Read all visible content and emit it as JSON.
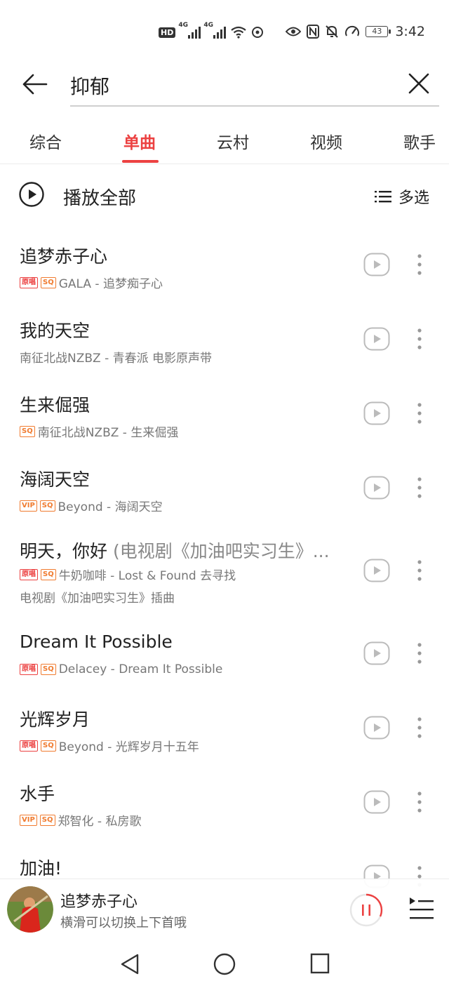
{
  "status_bar": {
    "time": "3:42",
    "battery": "43",
    "hd_label": "HD",
    "network_labels": [
      "4G",
      "4G"
    ],
    "icons": [
      "hd-icon",
      "signal-icon",
      "signal-icon",
      "wifi-icon",
      "sync-icon",
      "eye-icon",
      "nfc-icon",
      "bell-off-icon",
      "speedometer-icon",
      "battery-icon"
    ]
  },
  "search": {
    "query": "抑郁",
    "back_icon": "arrow-left-icon",
    "clear_icon": "close-icon"
  },
  "tabs": [
    {
      "label": "综合",
      "active": false
    },
    {
      "label": "单曲",
      "active": true
    },
    {
      "label": "云村",
      "active": false
    },
    {
      "label": "视频",
      "active": false
    },
    {
      "label": "歌手",
      "active": false
    }
  ],
  "toolbar": {
    "play_all_label": "播放全部",
    "multi_select_label": "多选"
  },
  "songs": [
    {
      "title": "追梦赤子心",
      "title_extra": "",
      "badges": [
        "原唱",
        "SQ"
      ],
      "meta": "GALA - 追梦痴子心",
      "sub": ""
    },
    {
      "title": "我的天空",
      "title_extra": "",
      "badges": [],
      "meta": "南征北战NZBZ - 青春派 电影原声带",
      "sub": ""
    },
    {
      "title": "生来倔强",
      "title_extra": "",
      "badges": [
        "SQ"
      ],
      "meta": "南征北战NZBZ - 生来倔强",
      "sub": ""
    },
    {
      "title": "海阔天空",
      "title_extra": "",
      "badges": [
        "VIP",
        "SQ"
      ],
      "meta": "Beyond - 海阔天空",
      "sub": ""
    },
    {
      "title": "明天，你好",
      "title_extra": " (电视剧《加油吧实习生》...",
      "badges": [
        "原唱",
        "SQ"
      ],
      "meta": "牛奶咖啡 - Lost & Found 去寻找",
      "sub": "电视剧《加油吧实习生》插曲"
    },
    {
      "title": "Dream It Possible",
      "title_extra": "",
      "badges": [
        "原唱",
        "SQ"
      ],
      "meta": "Delacey - Dream It Possible",
      "sub": ""
    },
    {
      "title": "光辉岁月",
      "title_extra": "",
      "badges": [
        "原唱",
        "SQ"
      ],
      "meta": "Beyond - 光辉岁月十五年",
      "sub": ""
    },
    {
      "title": "水手",
      "title_extra": "",
      "badges": [
        "VIP",
        "SQ"
      ],
      "meta": "郑智化 - 私房歌",
      "sub": ""
    },
    {
      "title": "加油!",
      "title_extra": "",
      "badges": [],
      "meta": "",
      "sub": ""
    }
  ],
  "mini_player": {
    "title": "追梦赤子心",
    "hint": "横滑可以切换上下首哦",
    "state": "playing"
  },
  "colors": {
    "accent": "#ec4141",
    "badge_orange": "#f07b2f",
    "text": "#222222",
    "subtext": "#777777"
  }
}
